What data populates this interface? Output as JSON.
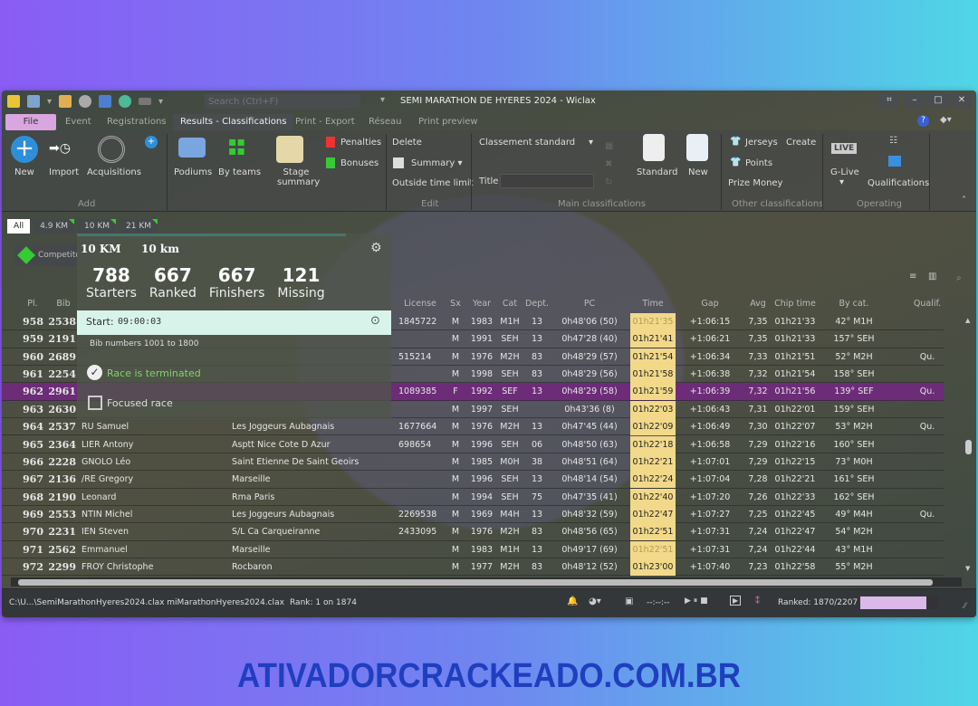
{
  "window": {
    "title": "SEMI MARATHON DE HYERES 2024 - Wiclax",
    "search_placeholder": "Search (Ctrl+F)"
  },
  "menu_tabs": [
    "File",
    "Event",
    "Registrations",
    "Results - Classifications",
    "Print - Export",
    "Réseau",
    "Print preview"
  ],
  "active_tab": "Results - Classifications",
  "ribbon": {
    "add": {
      "label": "Add",
      "new": "New",
      "import": "Import",
      "acquisitions": "Acquisitions"
    },
    "misc": {
      "podiums": "Podiums",
      "by_teams": "By teams",
      "stage_summary": "Stage summary",
      "penalties": "Penalties",
      "bonuses": "Bonuses"
    },
    "edit": {
      "label": "Edit",
      "delete": "Delete",
      "summary": "Summary",
      "outside": "Outside time limit"
    },
    "main": {
      "label": "Main classifications",
      "select": "Classement standard",
      "title_label": "Title",
      "standard": "Standard",
      "new": "New"
    },
    "other": {
      "label": "Other classifications",
      "jerseys": "Jerseys",
      "create": "Create",
      "points": "Points",
      "prize": "Prize Money"
    },
    "operating": {
      "label": "Operating",
      "glive": "G-Live",
      "live": "LIVE",
      "qualifications": "Qualifications"
    }
  },
  "race_tabs": [
    "All",
    "4.9 KM",
    "10 KM",
    "21 KM"
  ],
  "competitors_button": "Competitors",
  "popup": {
    "code": "10 KM",
    "name": "10 km",
    "stats": [
      {
        "value": "788",
        "label": "Starters"
      },
      {
        "value": "667",
        "label": "Ranked"
      },
      {
        "value": "667",
        "label": "Finishers"
      },
      {
        "value": "121",
        "label": "Missing"
      }
    ],
    "start_label": "Start:",
    "start_time": "09:00:03",
    "bib_range": "Bib numbers 1001 to 1800",
    "terminated": "Race is terminated",
    "focused": "Focused race"
  },
  "columns": [
    "Pl.",
    "Bib",
    "",
    "",
    "License",
    "Sx",
    "Year",
    "Cat",
    "Dept.",
    "PC",
    "Time",
    "Gap",
    "Avg",
    "Chip time",
    "By cat.",
    "Qualif."
  ],
  "rows": [
    {
      "pl": "958",
      "bib": "2538",
      "name": "",
      "club": "",
      "lic": "1845722",
      "sx": "M",
      "year": "1983",
      "cat": "M1H",
      "dept": "13",
      "pc": "0h48'06 (50)",
      "time": "01h21'35",
      "dim": true,
      "gap": "+1:06:15",
      "avg": "7,35",
      "chip": "01h21'33",
      "bycat": "42° M1H",
      "q": ""
    },
    {
      "pl": "959",
      "bib": "2191",
      "name": "",
      "club": "",
      "lic": "",
      "sx": "M",
      "year": "1991",
      "cat": "SEH",
      "dept": "13",
      "pc": "0h47'28 (40)",
      "time": "01h21'41",
      "gap": "+1:06:21",
      "avg": "7,35",
      "chip": "01h21'33",
      "bycat": "157° SEH",
      "q": ""
    },
    {
      "pl": "960",
      "bib": "2689",
      "name": "",
      "club": "",
      "lic": "515214",
      "sx": "M",
      "year": "1976",
      "cat": "M2H",
      "dept": "83",
      "pc": "0h48'29 (57)",
      "time": "01h21'54",
      "gap": "+1:06:34",
      "avg": "7,33",
      "chip": "01h21'51",
      "bycat": "52° M2H",
      "q": "Qu."
    },
    {
      "pl": "961",
      "bib": "2254",
      "name": "",
      "club": "",
      "lic": "",
      "sx": "M",
      "year": "1998",
      "cat": "SEH",
      "dept": "83",
      "pc": "0h48'29 (56)",
      "time": "01h21'58",
      "gap": "+1:06:38",
      "avg": "7,32",
      "chip": "01h21'54",
      "bycat": "158° SEH",
      "q": ""
    },
    {
      "pl": "962",
      "bib": "2961",
      "name": "",
      "club": "",
      "lic": "1089385",
      "sx": "F",
      "year": "1992",
      "cat": "SEF",
      "dept": "13",
      "pc": "0h48'29 (58)",
      "time": "01h21'59",
      "gap": "+1:06:39",
      "avg": "7,32",
      "chip": "01h21'56",
      "bycat": "139° SEF",
      "q": "Qu.",
      "sel": true
    },
    {
      "pl": "963",
      "bib": "2630",
      "name": "",
      "club": "",
      "lic": "",
      "sx": "M",
      "year": "1997",
      "cat": "SEH",
      "dept": "",
      "pc": "0h43'36 (8)",
      "time": "01h22'03",
      "gap": "+1:06:43",
      "avg": "7,31",
      "chip": "01h22'01",
      "bycat": "159° SEH",
      "q": ""
    },
    {
      "pl": "964",
      "bib": "2537",
      "name": "RU Samuel",
      "club": "Les Joggeurs Aubagnais",
      "lic": "1677664",
      "sx": "M",
      "year": "1976",
      "cat": "M2H",
      "dept": "13",
      "pc": "0h47'45 (44)",
      "time": "01h22'09",
      "gap": "+1:06:49",
      "avg": "7,30",
      "chip": "01h22'07",
      "bycat": "53° M2H",
      "q": "Qu."
    },
    {
      "pl": "965",
      "bib": "2364",
      "name": "LIER Antony",
      "club": "Asptt Nice Cote D Azur",
      "lic": "698654",
      "sx": "M",
      "year": "1996",
      "cat": "SEH",
      "dept": "06",
      "pc": "0h48'50 (63)",
      "time": "01h22'18",
      "gap": "+1:06:58",
      "avg": "7,29",
      "chip": "01h22'16",
      "bycat": "160° SEH",
      "q": ""
    },
    {
      "pl": "966",
      "bib": "2228",
      "name": "GNOLO Léo",
      "club": "Saint Etienne De Saint Geoirs",
      "lic": "",
      "sx": "M",
      "year": "1985",
      "cat": "M0H",
      "dept": "38",
      "pc": "0h48'51 (64)",
      "time": "01h22'21",
      "gap": "+1:07:01",
      "avg": "7,29",
      "chip": "01h22'15",
      "bycat": "73° M0H",
      "q": ""
    },
    {
      "pl": "967",
      "bib": "2136",
      "name": "/RE Gregory",
      "club": "Marseille",
      "lic": "",
      "sx": "M",
      "year": "1996",
      "cat": "SEH",
      "dept": "13",
      "pc": "0h48'14 (54)",
      "time": "01h22'24",
      "gap": "+1:07:04",
      "avg": "7,28",
      "chip": "01h22'21",
      "bycat": "161° SEH",
      "q": ""
    },
    {
      "pl": "968",
      "bib": "2190",
      "name": "Leonard",
      "club": "Rma Paris",
      "lic": "",
      "sx": "M",
      "year": "1994",
      "cat": "SEH",
      "dept": "75",
      "pc": "0h47'35 (41)",
      "time": "01h22'40",
      "gap": "+1:07:20",
      "avg": "7,26",
      "chip": "01h22'33",
      "bycat": "162° SEH",
      "q": ""
    },
    {
      "pl": "969",
      "bib": "2553",
      "name": "NTIN Michel",
      "club": "Les Joggeurs Aubagnais",
      "lic": "2269538",
      "sx": "M",
      "year": "1969",
      "cat": "M4H",
      "dept": "13",
      "pc": "0h48'32 (59)",
      "time": "01h22'47",
      "gap": "+1:07:27",
      "avg": "7,25",
      "chip": "01h22'45",
      "bycat": "49° M4H",
      "q": "Qu."
    },
    {
      "pl": "970",
      "bib": "2231",
      "name": "IEN Steven",
      "club": "S/L Ca Carqueiranne",
      "lic": "2433095",
      "sx": "M",
      "year": "1976",
      "cat": "M2H",
      "dept": "83",
      "pc": "0h48'56 (65)",
      "time": "01h22'51",
      "gap": "+1:07:31",
      "avg": "7,24",
      "chip": "01h22'47",
      "bycat": "54° M2H",
      "q": ""
    },
    {
      "pl": "971",
      "bib": "2562",
      "name": "Emmanuel",
      "club": "Marseille",
      "lic": "",
      "sx": "M",
      "year": "1983",
      "cat": "M1H",
      "dept": "13",
      "pc": "0h49'17 (69)",
      "time": "01h22'51",
      "dim": true,
      "gap": "+1:07:31",
      "avg": "7,24",
      "chip": "01h22'44",
      "bycat": "43° M1H",
      "q": ""
    },
    {
      "pl": "972",
      "bib": "2299",
      "name": "FROY Christophe",
      "club": "Rocbaron",
      "lic": "",
      "sx": "M",
      "year": "1977",
      "cat": "M2H",
      "dept": "83",
      "pc": "0h48'12 (52)",
      "time": "01h23'00",
      "gap": "+1:07:40",
      "avg": "7,23",
      "chip": "01h22'58",
      "bycat": "55° M2H",
      "q": ""
    }
  ],
  "status": {
    "path": "C:\\U...\\SemiMarathonHyeres2024.clax  miMarathonHyeres2024.clax",
    "rank": "Rank: 1 on 1874",
    "clock": "--:--:--",
    "ranked": "Ranked: 1870/2207"
  },
  "watermark": "ATIVADORCRACKEADO.COM.BR",
  "colors": {
    "selected_row": "#6d2c78",
    "time_cell": "#f2d98a",
    "file_tab": "#d9a6e0",
    "accent": "#2ed3d8"
  }
}
